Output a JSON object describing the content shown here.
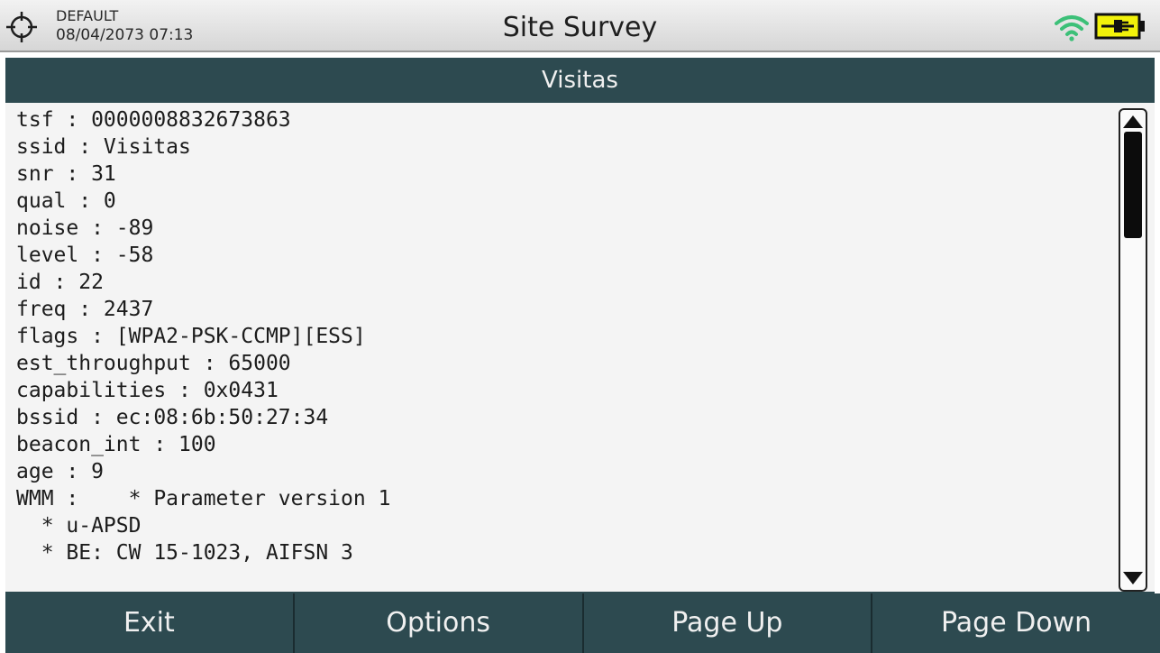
{
  "status_bar": {
    "profile": "DEFAULT",
    "datetime": "08/04/2073 07:13",
    "title": "Site Survey",
    "icons": [
      "crosshair-icon",
      "wifi-icon",
      "battery-charging-icon"
    ]
  },
  "section": {
    "title": "Visitas"
  },
  "details": {
    "lines": [
      "tsf : 0000008832673863",
      "ssid : Visitas",
      "snr : 31",
      "qual : 0",
      "noise : -89",
      "level : -58",
      "id : 22",
      "freq : 2437",
      "flags : [WPA2-PSK-CCMP][ESS]",
      "est_throughput : 65000",
      "capabilities : 0x0431",
      "bssid : ec:08:6b:50:27:34",
      "beacon_int : 100",
      "age : 9",
      "WMM :    * Parameter version 1",
      "  * u-APSD",
      "  * BE: CW 15-1023, AIFSN 3"
    ]
  },
  "softkeys": {
    "exit": "Exit",
    "options": "Options",
    "page_up": "Page Up",
    "page_down": "Page Down"
  },
  "colors": {
    "header_bg": "#2d4a50",
    "battery_fill": "#f2f20a"
  }
}
